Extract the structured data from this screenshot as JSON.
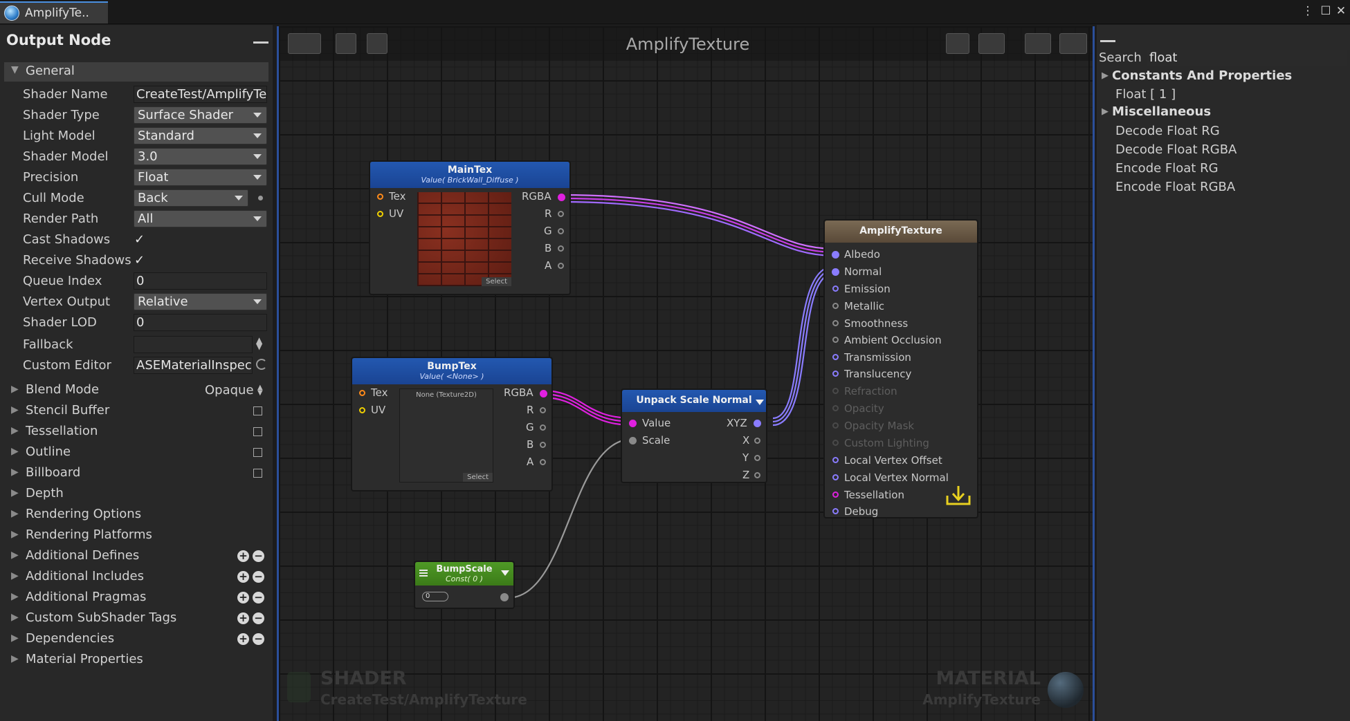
{
  "window": {
    "tab_title": "AmplifyTe..",
    "win_menu": "⋮",
    "win_max": "☐",
    "win_close": "✕"
  },
  "left_panel": {
    "title": "Output Node",
    "general_header": "General",
    "props": [
      {
        "label": "Shader Name",
        "value": "CreateTest/AmplifyTe"
      },
      {
        "label": "Shader Type",
        "value": "Surface Shader"
      },
      {
        "label": "Light Model",
        "value": "Standard"
      },
      {
        "label": "Shader Model",
        "value": "3.0"
      },
      {
        "label": "Precision",
        "value": "Float"
      },
      {
        "label": "Cull Mode",
        "value": "Back"
      },
      {
        "label": "Render Path",
        "value": "All"
      },
      {
        "label": "Cast Shadows",
        "value": "✓"
      },
      {
        "label": "Receive Shadows",
        "value": "✓"
      },
      {
        "label": "Queue Index",
        "value": "0"
      },
      {
        "label": "Vertex Output",
        "value": "Relative"
      },
      {
        "label": "Shader LOD",
        "value": "0"
      },
      {
        "label": "Fallback",
        "value": ""
      },
      {
        "label": "Custom Editor",
        "value": "ASEMaterialInspec"
      }
    ],
    "blend_mode": {
      "label": "Blend Mode",
      "value": "Opaque"
    },
    "sections": [
      {
        "label": "Stencil Buffer"
      },
      {
        "label": "Tessellation"
      },
      {
        "label": "Outline"
      },
      {
        "label": "Billboard"
      },
      {
        "label": "Depth"
      },
      {
        "label": "Rendering Options"
      },
      {
        "label": "Rendering Platforms"
      },
      {
        "label": "Additional Defines"
      },
      {
        "label": "Additional Includes"
      },
      {
        "label": "Additional Pragmas"
      },
      {
        "label": "Custom SubShader Tags"
      },
      {
        "label": "Dependencies"
      },
      {
        "label": "Material Properties"
      }
    ]
  },
  "canvas": {
    "title": "AmplifyTexture",
    "shader_label": "SHADER",
    "shader_path": "CreateTest/AmplifyTexture",
    "material_label": "MATERIAL",
    "material_name": "AmplifyTexture"
  },
  "nodes": {
    "maintex": {
      "title": "MainTex",
      "subtitle": "Value( BrickWall_Diffuse )",
      "inputs": [
        "Tex",
        "UV"
      ],
      "outputs": [
        "RGBA",
        "R",
        "G",
        "B",
        "A"
      ],
      "select": "Select"
    },
    "bumptex": {
      "title": "BumpTex",
      "subtitle": "Value( <None> )",
      "inputs": [
        "Tex",
        "UV"
      ],
      "outputs": [
        "RGBA",
        "R",
        "G",
        "B",
        "A"
      ],
      "preview_text": "None (Texture2D)",
      "select": "Select"
    },
    "unpack": {
      "title": "Unpack Scale Normal",
      "inputs": [
        "Value",
        "Scale"
      ],
      "outputs": [
        "XYZ",
        "X",
        "Y",
        "Z"
      ]
    },
    "bumpscale": {
      "title": "BumpScale",
      "subtitle": "Const( 0 )",
      "value": "0"
    },
    "output": {
      "title": "AmplifyTexture",
      "inputs": [
        "Albedo",
        "Normal",
        "Emission",
        "Metallic",
        "Smoothness",
        "Ambient Occlusion",
        "Transmission",
        "Translucency",
        "Refraction",
        "Opacity",
        "Opacity Mask",
        "Custom Lighting",
        "Local Vertex Offset",
        "Local Vertex Normal",
        "Tessellation",
        "Debug"
      ]
    }
  },
  "right_panel": {
    "search_label": "Search",
    "search_value": "float",
    "categories": [
      {
        "label": "Constants And Properties",
        "items": [
          "Float [ 1 ]"
        ]
      },
      {
        "label": "Miscellaneous",
        "items": [
          "Decode Float RG",
          "Decode Float RGBA",
          "Encode Float RG",
          "Encode Float RGBA"
        ]
      }
    ]
  },
  "colors": {
    "accent": "#2b4f9a",
    "node_header": "#1f4fa3",
    "wire_pink": "#e020e0",
    "wire_purple": "#8a7cff",
    "bumpscale_header": "#4a8a22",
    "output_header": "#6a5a44"
  }
}
